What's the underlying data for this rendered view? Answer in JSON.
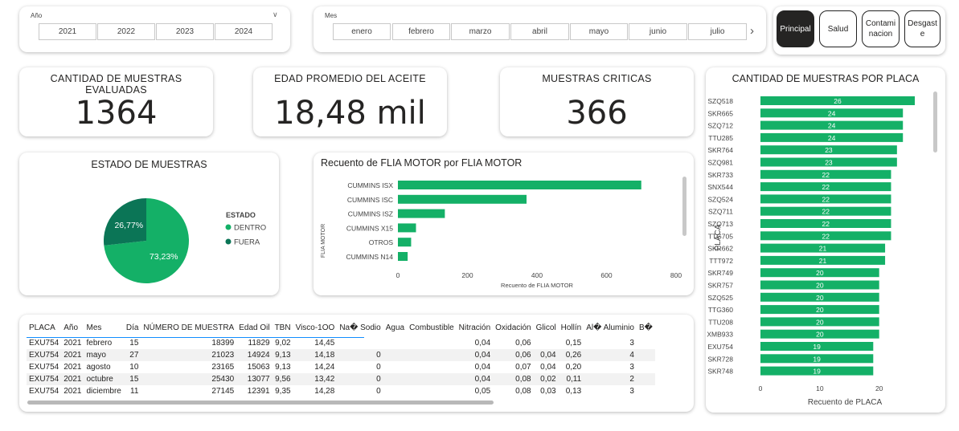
{
  "year_slicer": {
    "label": "Año",
    "years": [
      "2021",
      "2022",
      "2023",
      "2024"
    ]
  },
  "month_slicer": {
    "label": "Mes",
    "months": [
      "enero",
      "febrero",
      "marzo",
      "abril",
      "mayo",
      "junio",
      "julio"
    ]
  },
  "nav": {
    "principal": "Principal",
    "salud": "Salud",
    "contaminacion": "Contami nacion",
    "desgaste": "Desgast e"
  },
  "kpis": [
    {
      "title": "CANTIDAD DE MUESTRAS EVALUADAS",
      "value": "1364"
    },
    {
      "title": "EDAD PROMEDIO DEL ACEITE",
      "value": "18,48 mil"
    },
    {
      "title": "MUESTRAS CRITICAS",
      "value": "366"
    }
  ],
  "pie": {
    "title": "ESTADO DE MUESTRAS",
    "legend_title": "ESTADO",
    "colors": {
      "dentro": "#14b067",
      "fuera": "#0b7556"
    }
  },
  "flia": {
    "title": "Recuento de FLIA MOTOR por FLIA MOTOR",
    "color": "#14b067"
  },
  "placa_chart": {
    "title": "CANTIDAD DE MUESTRAS POR PLACA",
    "color": "#14b067"
  },
  "chart_data": [
    {
      "type": "pie",
      "title": "ESTADO DE MUESTRAS",
      "legend_title": "ESTADO",
      "legend_position": "right",
      "labels": [
        "DENTRO",
        "FUERA"
      ],
      "values": [
        73.23,
        26.77
      ],
      "value_labels": [
        "73,23%",
        "26,77%"
      ]
    },
    {
      "type": "bar",
      "orientation": "horizontal",
      "title": "Recuento de FLIA MOTOR por FLIA MOTOR",
      "xlabel": "Recuento de FLIA MOTOR",
      "ylabel": "FLIA MOTOR",
      "categories": [
        "CUMMINS ISX",
        "CUMMINS ISC",
        "CUMMINS ISZ",
        "CUMMINS X15",
        "OTROS",
        "CUMMINS N14"
      ],
      "values": [
        700,
        370,
        135,
        52,
        38,
        28
      ],
      "xlim": [
        0,
        800
      ],
      "xticks": [
        "0",
        "200",
        "400",
        "600",
        "800"
      ]
    },
    {
      "type": "bar",
      "orientation": "horizontal",
      "title": "CANTIDAD DE MUESTRAS POR PLACA",
      "xlabel": "Recuento de PLACA",
      "ylabel": "PLACA",
      "categories": [
        "SZQ518",
        "SKR665",
        "SZQ712",
        "TTU285",
        "SKR764",
        "SZQ981",
        "SKR733",
        "SNX544",
        "SZQ524",
        "SZQ711",
        "SZQ713",
        "TTG705",
        "SKR662",
        "TTT972",
        "SKR749",
        "SKR757",
        "SZQ525",
        "TTG360",
        "TTU208",
        "XMB933",
        "EXU754",
        "SKR728",
        "SKR748"
      ],
      "values": [
        26,
        24,
        24,
        24,
        23,
        23,
        22,
        22,
        22,
        22,
        22,
        22,
        21,
        21,
        20,
        20,
        20,
        20,
        20,
        20,
        19,
        19,
        19
      ],
      "xlim": [
        0,
        26
      ],
      "xticks": [
        "0",
        "10",
        "20"
      ]
    }
  ],
  "table": {
    "columns": [
      "PLACA",
      "Año",
      "Mes",
      "Día",
      "NÚMERO DE MUESTRA",
      "Edad Oil",
      "TBN",
      "Visco-1OO",
      "Na� Sodio",
      "Agua",
      "Combustible",
      "Nitración",
      "Oxidación",
      "Glicol",
      "Hollín",
      "Al� Aluminio",
      "B�"
    ],
    "rows": [
      [
        "EXU754",
        "2021",
        "febrero",
        "15",
        "18399",
        "11829",
        "9,02",
        "14,45",
        "",
        "",
        "",
        "0,04",
        "0,06",
        "",
        "0,15",
        "3",
        ""
      ],
      [
        "EXU754",
        "2021",
        "mayo",
        "27",
        "21023",
        "14924",
        "9,13",
        "14,18",
        "0",
        "",
        "",
        "0,04",
        "0,06",
        "0,04",
        "0,26",
        "4",
        ""
      ],
      [
        "EXU754",
        "2021",
        "agosto",
        "10",
        "23165",
        "15063",
        "9,13",
        "14,24",
        "0",
        "",
        "",
        "0,04",
        "0,07",
        "0,04",
        "0,20",
        "3",
        ""
      ],
      [
        "EXU754",
        "2021",
        "octubre",
        "15",
        "25430",
        "13077",
        "9,56",
        "13,42",
        "0",
        "",
        "",
        "0,04",
        "0,08",
        "0,02",
        "0,11",
        "2",
        ""
      ],
      [
        "EXU754",
        "2021",
        "diciembre",
        "11",
        "27145",
        "12391",
        "9,35",
        "14,28",
        "0",
        "",
        "",
        "0,05",
        "0,08",
        "0,03",
        "0,13",
        "3",
        ""
      ]
    ]
  }
}
